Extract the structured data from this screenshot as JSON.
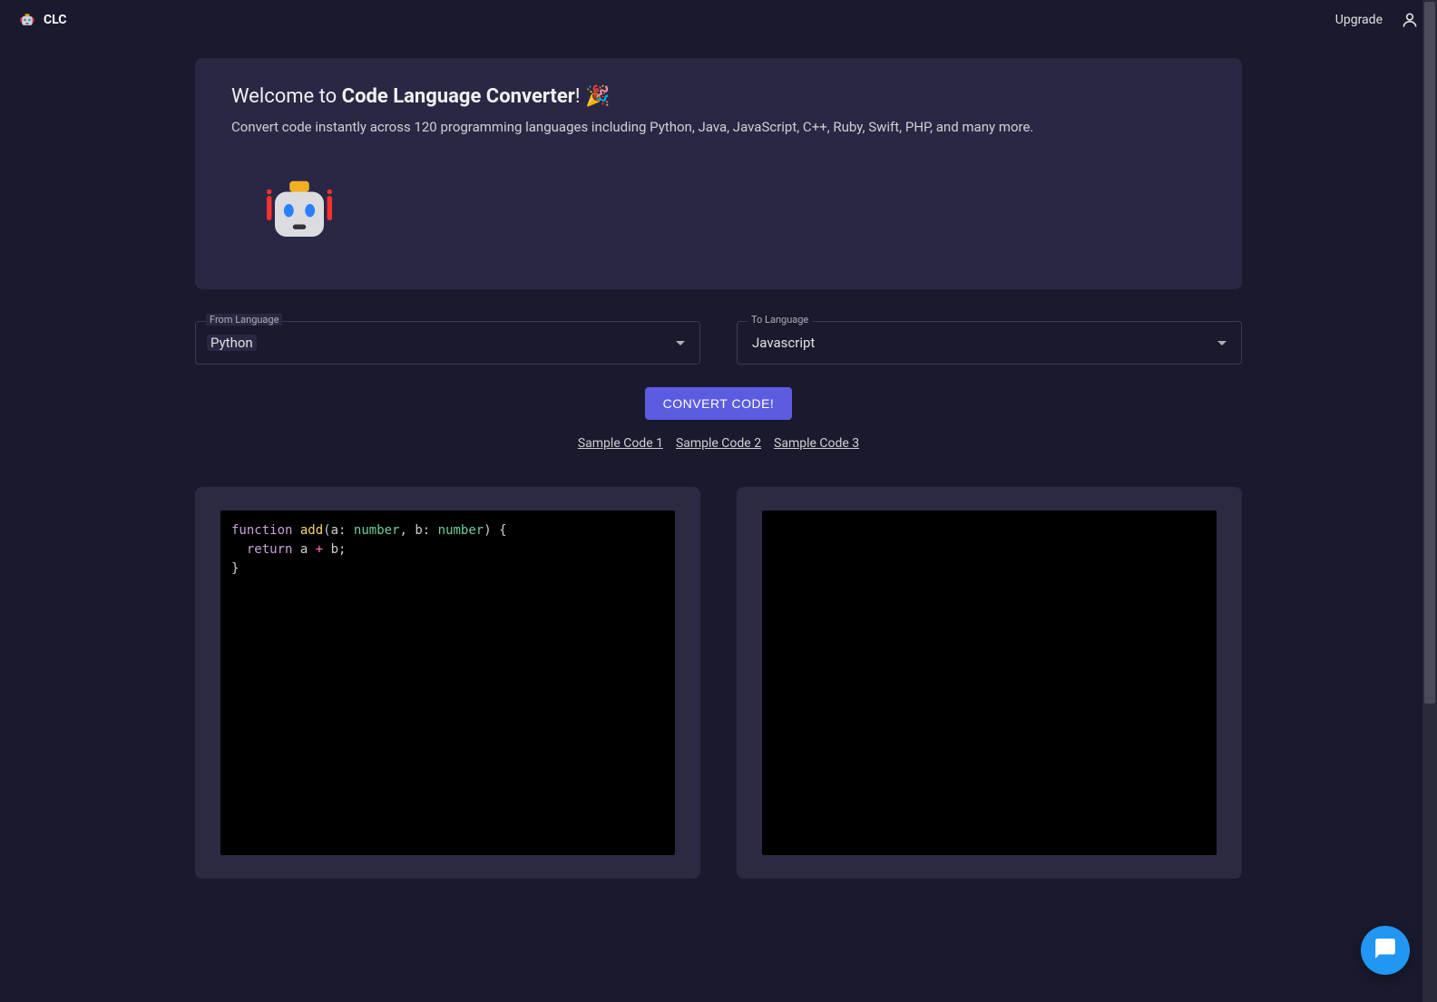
{
  "header": {
    "logo_text": "CLC",
    "upgrade_label": "Upgrade"
  },
  "welcome": {
    "title_prefix": "Welcome to ",
    "title_bold": "Code Language Converter",
    "title_suffix": "! 🎉",
    "subtitle": "Convert code instantly across 120 programming languages including Python, Java, JavaScript, C++, Ruby, Swift, PHP, and many more."
  },
  "from_select": {
    "label": "From Language",
    "value": "Python"
  },
  "to_select": {
    "label": "To Language",
    "value": "Javascript"
  },
  "convert_button": "CONVERT CODE!",
  "sample_links": [
    "Sample Code 1",
    "Sample Code 2",
    "Sample Code 3"
  ],
  "source_code": {
    "tokens": [
      {
        "t": "function",
        "c": "keyword"
      },
      {
        "t": " ",
        "c": "punc"
      },
      {
        "t": "add",
        "c": "func"
      },
      {
        "t": "(",
        "c": "punc"
      },
      {
        "t": "a",
        "c": "param"
      },
      {
        "t": ": ",
        "c": "punc"
      },
      {
        "t": "number",
        "c": "type"
      },
      {
        "t": ", ",
        "c": "punc"
      },
      {
        "t": "b",
        "c": "param"
      },
      {
        "t": ": ",
        "c": "punc"
      },
      {
        "t": "number",
        "c": "type"
      },
      {
        "t": ")",
        "c": "punc"
      },
      {
        "t": " {",
        "c": "punc"
      },
      {
        "t": "\n  ",
        "c": "punc"
      },
      {
        "t": "return",
        "c": "keyword"
      },
      {
        "t": " a ",
        "c": "punc"
      },
      {
        "t": "+",
        "c": "op"
      },
      {
        "t": " b;",
        "c": "punc"
      },
      {
        "t": "\n}",
        "c": "punc"
      }
    ]
  },
  "target_code": ""
}
